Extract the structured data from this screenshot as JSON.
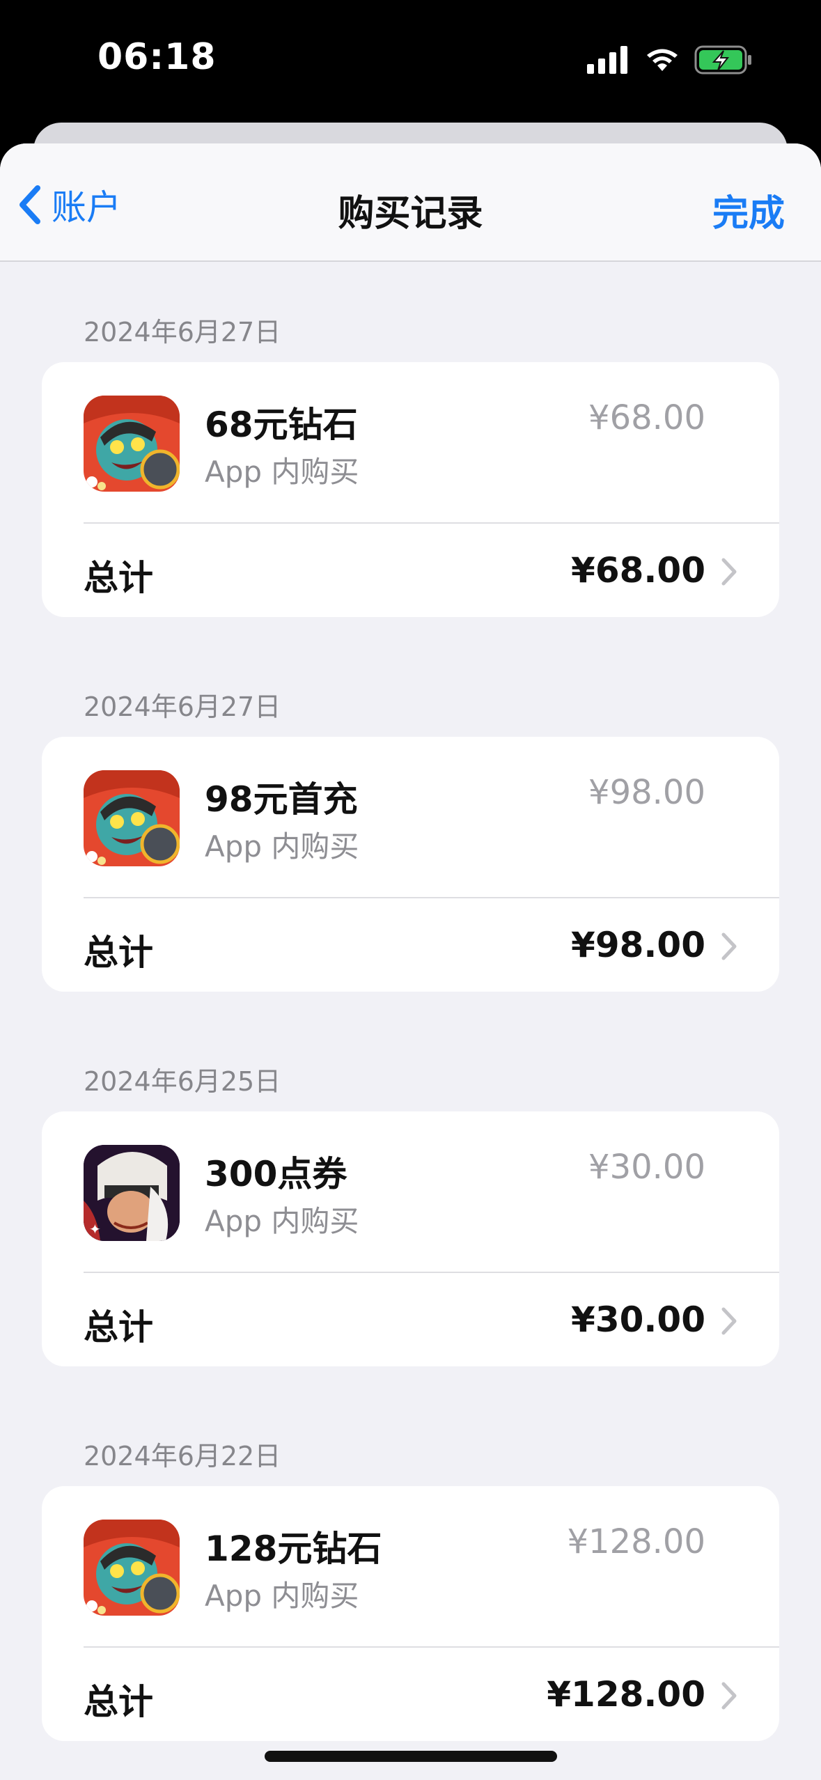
{
  "status_bar": {
    "time": "06:18"
  },
  "nav": {
    "back_label": "账户",
    "title": "购买记录",
    "done_label": "完成"
  },
  "purchases": [
    {
      "date": "2024年6月27日",
      "item": "68元钻石",
      "type": "App 内购买",
      "price": "¥68.00",
      "total_label": "总计",
      "total": "¥68.00",
      "icon": "game-monster-icon"
    },
    {
      "date": "2024年6月27日",
      "item": "98元首充",
      "type": "App 内购买",
      "price": "¥98.00",
      "total_label": "总计",
      "total": "¥98.00",
      "icon": "game-monster-icon"
    },
    {
      "date": "2024年6月25日",
      "item": "300点券",
      "type": "App 内购买",
      "price": "¥30.00",
      "total_label": "总计",
      "total": "¥30.00",
      "icon": "game-hero-icon"
    },
    {
      "date": "2024年6月22日",
      "item": "128元钻石",
      "type": "App 内购买",
      "price": "¥128.00",
      "total_label": "总计",
      "total": "¥128.00",
      "icon": "game-monster-icon"
    }
  ]
}
